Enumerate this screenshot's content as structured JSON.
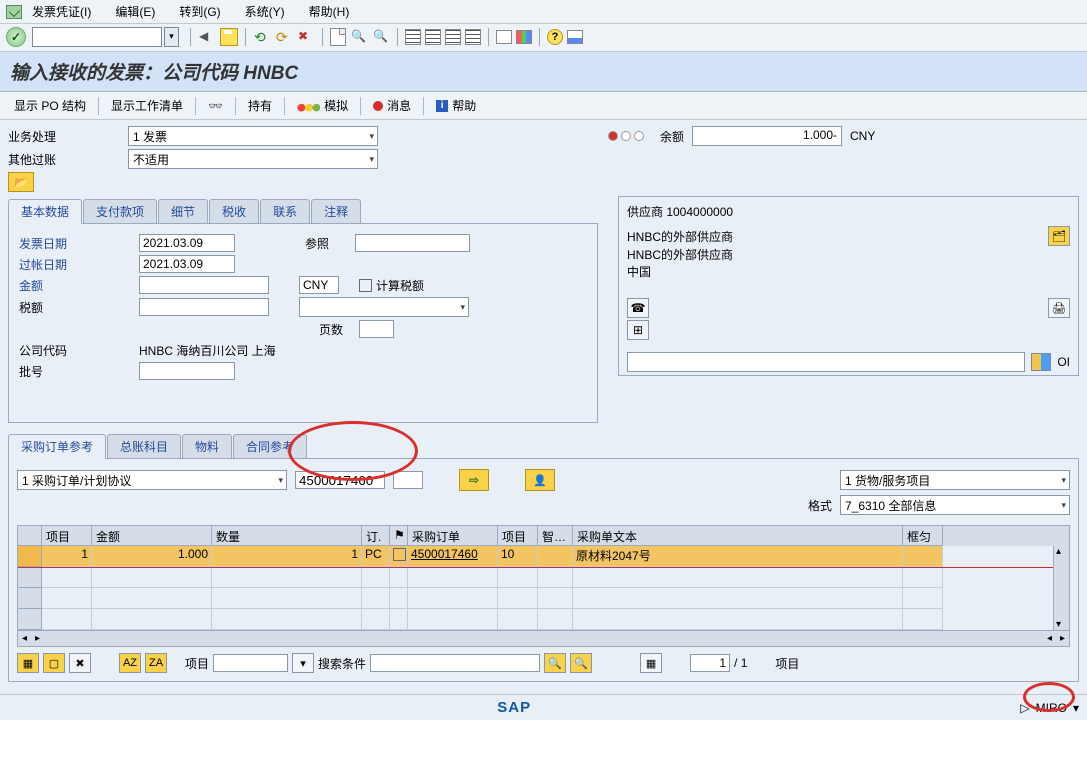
{
  "menu": {
    "invoice": "发票凭证(I)",
    "edit": "编辑(E)",
    "goto": "转到(G)",
    "system": "系统(Y)",
    "help": "帮助(H)"
  },
  "title": "输入接收的发票：公司代码 HNBC",
  "apptool": {
    "showPO": "显示 PO 结构",
    "workList": "显示工作清单",
    "hold": "持有",
    "simulate": "模拟",
    "messages": "消息",
    "help": "帮助"
  },
  "hdr": {
    "businessLbl": "业务处理",
    "business": "1 发票",
    "otherLbl": "其他过账",
    "other": "不适用",
    "balanceLbl": "余额",
    "balanceVal": "1.000-",
    "currency": "CNY"
  },
  "tabs1": {
    "basic": "基本数据",
    "payment": "支付款项",
    "detail": "细节",
    "tax": "税收",
    "contact": "联系",
    "note": "注释"
  },
  "basic": {
    "invDateLbl": "发票日期",
    "invDate": "2021.03.09",
    "refLbl": "参照",
    "ref": "",
    "postDateLbl": "过帐日期",
    "postDate": "2021.03.09",
    "amountLbl": "金额",
    "amount": "",
    "cur": "CNY",
    "calcTaxLbl": "计算税额",
    "taxLbl": "税额",
    "tax": "",
    "pagesLbl": "页数",
    "pages": "",
    "ccLbl": "公司代码",
    "ccText": "HNBC 海纳百川公司 上海",
    "batchLbl": "批号",
    "batch": ""
  },
  "vendor": {
    "head": "供应商 1004000000",
    "name1": "HNBC的外部供应商",
    "name2": "HNBC的外部供应商",
    "country": "中国",
    "oi": "OI"
  },
  "tabs2": {
    "poRef": "采购订单参考",
    "gl": "总账科目",
    "mat": "物料",
    "contract": "合同参考"
  },
  "lower": {
    "refType": "1 采购订单/计划协议",
    "po": "4500017460",
    "layoutLbl": "格式",
    "layoutSelLbl": "货物/服务项目",
    "layoutSel": "1 货物/服务项目",
    "layout": "7_6310 全部信息"
  },
  "grid": {
    "cols": {
      "item": "项目",
      "amount": "金额",
      "qty": "数量",
      "ord": "订.",
      "pf": "",
      "po": "采购订单",
      "it": "项目",
      "sm": "智…",
      "txt": "采购单文本",
      "fa": "框匀"
    },
    "row": {
      "item": "1",
      "amount": "1.000",
      "qty": "1",
      "unit": "PC",
      "po": "4500017460",
      "poItem": "10",
      "text": "原材料2047号"
    }
  },
  "gfoot": {
    "itemLbl": "项目",
    "item": "",
    "searchLbl": "搜索条件",
    "page": "1",
    "of": "/ 1",
    "itemsLbl": "项目"
  },
  "status": {
    "tcode": "MIRO",
    "sap": "SAP"
  }
}
